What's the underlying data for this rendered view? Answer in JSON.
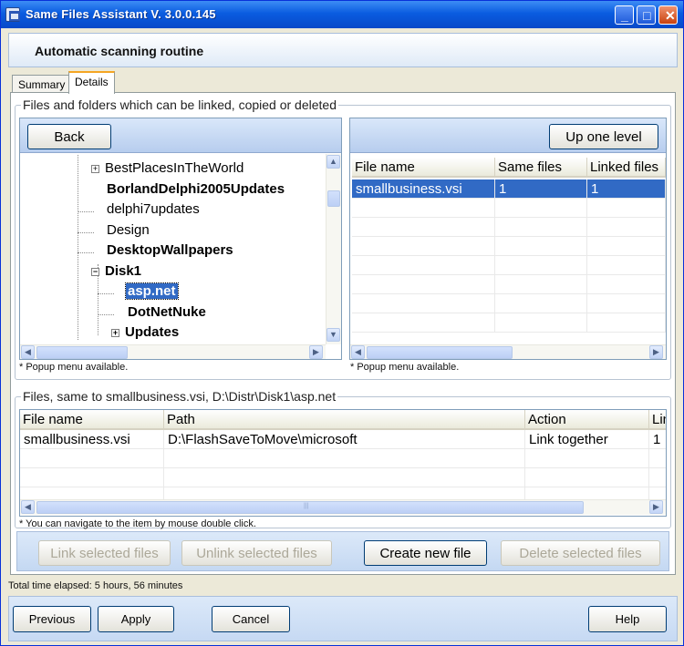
{
  "window": {
    "title": "Same Files Assistant V. 3.0.0.145",
    "minimize": "_",
    "maximize": "□",
    "close": "✕"
  },
  "header": {
    "title": "Automatic scanning routine"
  },
  "tabs": [
    {
      "label": "Summary",
      "active": false
    },
    {
      "label": "Details",
      "active": true
    }
  ],
  "files_group": {
    "title": "Files and folders which can be linked, copied or deleted",
    "left_pane": {
      "back_button": "Back",
      "tree": [
        {
          "label": "BestPlacesInTheWorld",
          "bold": false,
          "expander": "+"
        },
        {
          "label": "BorlandDelphi2005Updates",
          "bold": true,
          "expander": ""
        },
        {
          "label": "delphi7updates",
          "bold": false,
          "expander": ""
        },
        {
          "label": "Design",
          "bold": false,
          "expander": ""
        },
        {
          "label": "DesktopWallpapers",
          "bold": true,
          "expander": ""
        },
        {
          "label": "Disk1",
          "bold": true,
          "expander": "−"
        },
        {
          "label": "asp.net",
          "bold": true,
          "expander": "",
          "selected": true
        },
        {
          "label": "DotNetNuke",
          "bold": true,
          "expander": ""
        },
        {
          "label": "Updates",
          "bold": true,
          "expander": "+"
        }
      ],
      "hint": "* Popup menu available."
    },
    "right_pane": {
      "up_button": "Up one level",
      "columns": [
        "File name",
        "Same files",
        "Linked files"
      ],
      "rows": [
        [
          "smallbusiness.vsi",
          "1",
          "1"
        ]
      ],
      "hint": "* Popup menu available."
    }
  },
  "same_group": {
    "title": "Files, same to smallbusiness.vsi, D:\\Distr\\Disk1\\asp.net",
    "columns": [
      "File name",
      "Path",
      "Action",
      "Lin"
    ],
    "rows": [
      [
        "smallbusiness.vsi",
        "D:\\FlashSaveToMove\\microsoft",
        "Link together",
        "1"
      ]
    ],
    "hint": "* You can navigate to the item by mouse double click."
  },
  "actions": {
    "link": "Link selected files",
    "unlink": "Unlink selected files",
    "create": "Create new file",
    "delete": "Delete selected files"
  },
  "status": {
    "text": "Total time elapsed: 5 hours, 56 minutes"
  },
  "bottom": {
    "previous": "Previous",
    "apply": "Apply",
    "cancel": "Cancel",
    "help": "Help"
  },
  "icons": {
    "scroll_up": "▲",
    "scroll_down": "▼",
    "scroll_left": "◀",
    "scroll_right": "▶",
    "grip": "|||"
  }
}
